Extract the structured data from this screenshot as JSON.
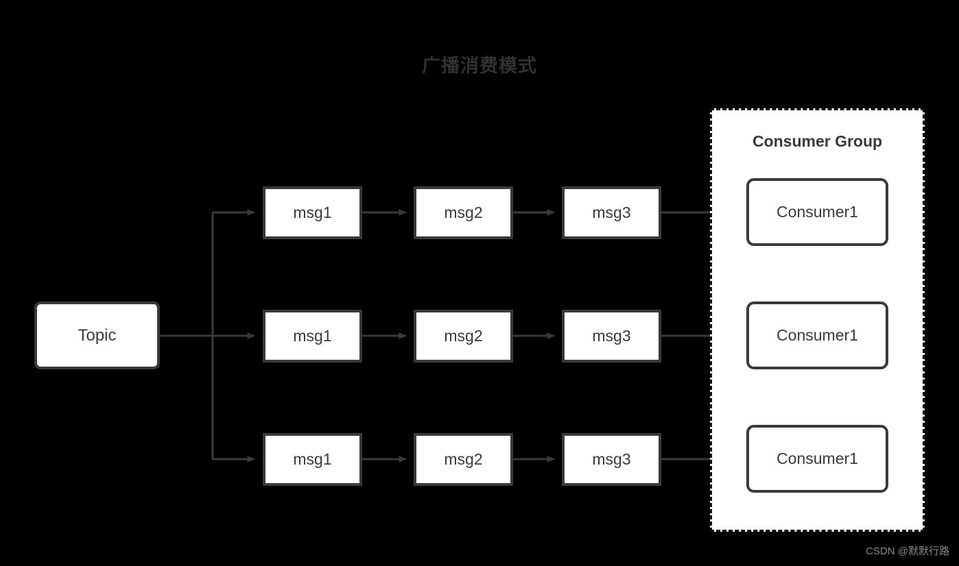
{
  "diagram": {
    "title": "广播消费模式",
    "background_color": "#000000",
    "node_fill": "#ffffff",
    "node_border_color": "#3a3a3a",
    "edge_color": "#3a3a3a",
    "title_color": "#33312f"
  },
  "source": {
    "label": "Topic",
    "name": "topic-node"
  },
  "consumer_group": {
    "title": "Consumer Group",
    "border_style": "dashed",
    "border_color": "#111111"
  },
  "rows": [
    {
      "messages": [
        {
          "label": "msg1"
        },
        {
          "label": "msg2"
        },
        {
          "label": "msg3"
        }
      ],
      "consumer": {
        "label": "Consumer1"
      }
    },
    {
      "messages": [
        {
          "label": "msg1"
        },
        {
          "label": "msg2"
        },
        {
          "label": "msg3"
        }
      ],
      "consumer": {
        "label": "Consumer1"
      }
    },
    {
      "messages": [
        {
          "label": "msg1"
        },
        {
          "label": "msg2"
        },
        {
          "label": "msg3"
        }
      ],
      "consumer": {
        "label": "Consumer1"
      }
    }
  ],
  "watermark": {
    "text": "CSDN @默默行路"
  }
}
